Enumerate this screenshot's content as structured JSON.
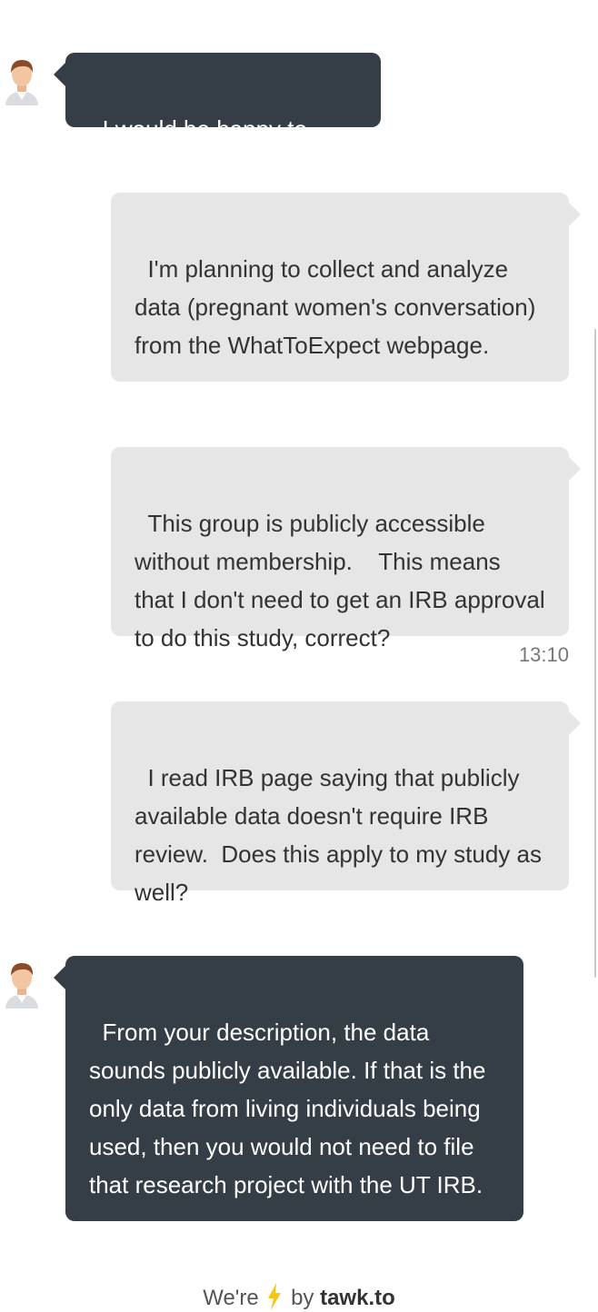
{
  "messages": [
    {
      "sender": "agent",
      "text": "I would be happy to help"
    },
    {
      "sender": "visitor",
      "text": "I'm planning to collect and analyze data (pregnant women's conversation) from the WhatToExpect webpage."
    },
    {
      "sender": "visitor",
      "text": "This group is publicly accessible without membership.    This means that I don't need to get an IRB approval to do this study, correct?",
      "time": "13:10"
    },
    {
      "sender": "visitor",
      "text": "I read IRB page saying that publicly available data doesn't require IRB review.  Does this apply to my study as well?"
    },
    {
      "sender": "agent",
      "text": "From your description, the data sounds publicly available. If that is the only data from living individuals being used, then you would not need to file that research project with the UT IRB."
    }
  ],
  "footer": {
    "prefix": "We're",
    "middle": "by",
    "brand": "tawk.to",
    "icon": "lightning-bolt-icon"
  },
  "colors": {
    "agent_bubble": "#353e47",
    "visitor_bubble": "#e6e6e6",
    "bolt": "#f5c518"
  }
}
